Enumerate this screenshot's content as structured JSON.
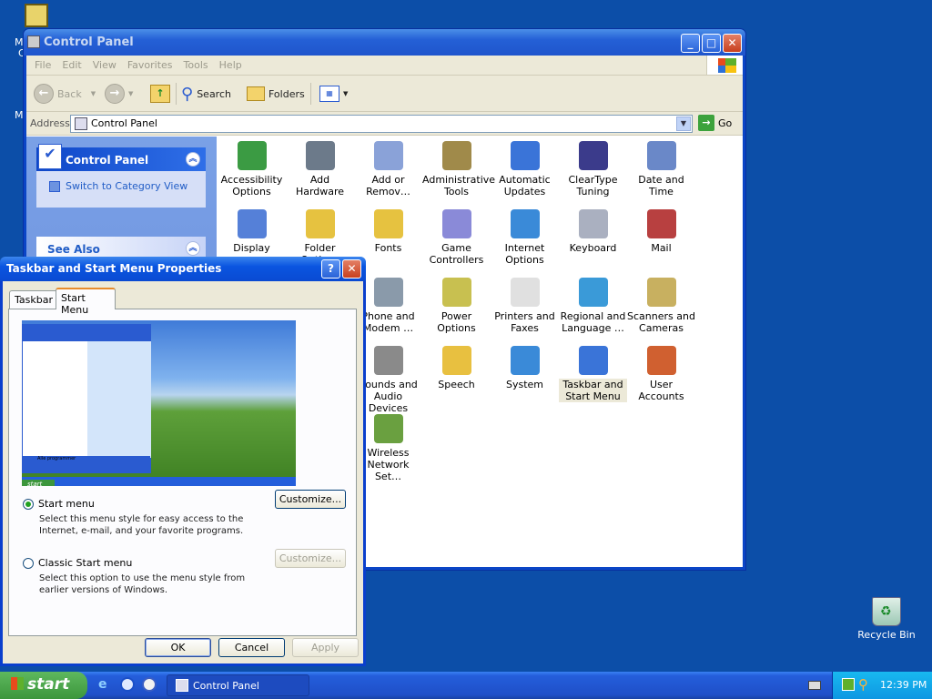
{
  "desktop": {
    "recycle_bin_label": "Recycle Bin",
    "icon_top_partial_label": "M",
    "icon_top_partial_label2": "C",
    "icon_mid_partial_label": "M"
  },
  "control_panel_window": {
    "title": "Control Panel",
    "menu": [
      "File",
      "Edit",
      "View",
      "Favorites",
      "Tools",
      "Help"
    ],
    "toolbar": {
      "back": "Back",
      "search": "Search",
      "folders": "Folders"
    },
    "address": {
      "label": "Address",
      "value": "Control Panel",
      "go": "Go"
    },
    "left_pane": {
      "control_panel_header": "Control Panel",
      "switch_view_link": "Switch to Category View",
      "see_also_header": "See Also"
    },
    "items": [
      {
        "label": "Accessibility\nOptions"
      },
      {
        "label": "Add Hardware"
      },
      {
        "label": "Add or\nRemov…"
      },
      {
        "label": "Administrative\nTools"
      },
      {
        "label": "Automatic\nUpdates"
      },
      {
        "label": "ClearType\nTuning"
      },
      {
        "label": "Date and Time"
      },
      {
        "label": "Display"
      },
      {
        "label": "Folder Options"
      },
      {
        "label": "Fonts"
      },
      {
        "label": "Game\nControllers"
      },
      {
        "label": "Internet\nOptions"
      },
      {
        "label": "Keyboard"
      },
      {
        "label": "Mail"
      },
      {
        "label": "Phone and\nModem …"
      },
      {
        "label": "Power Options"
      },
      {
        "label": "Printers and\nFaxes"
      },
      {
        "label": "Regional and\nLanguage …"
      },
      {
        "label": "Scanners and\nCameras"
      },
      {
        "label": "Sounds and\nAudio Devices"
      },
      {
        "label": "Speech"
      },
      {
        "label": "System"
      },
      {
        "label": "Taskbar and\nStart Menu"
      },
      {
        "label": "User Accounts"
      },
      {
        "label": "Wireless\nNetwork Set…"
      }
    ]
  },
  "dialog": {
    "title": "Taskbar and Start Menu Properties",
    "tabs": [
      "Taskbar",
      "Start Menu"
    ],
    "preview": {
      "start_label": "start",
      "all_programs": "Alle programmer"
    },
    "option_start_menu": {
      "label": "Start menu",
      "description": "Select this menu style for easy access to the Internet, e-mail, and your favorite programs.",
      "customize": "Customize...",
      "selected": true
    },
    "option_classic": {
      "label": "Classic Start menu",
      "description": "Select this option to use the menu style from earlier versions of Windows.",
      "customize": "Customize...",
      "selected": false
    },
    "buttons": {
      "ok": "OK",
      "cancel": "Cancel",
      "apply": "Apply"
    }
  },
  "taskbar": {
    "start": "start",
    "task_label": "Control Panel",
    "clock": "12:39 PM"
  },
  "colors": {
    "desktop": "#0c4ea8",
    "title_active": "#0a55e0",
    "title_inactive": "#2460d6",
    "taskbar": "#245edb",
    "start_green": "#3c963c",
    "tray": "#0e97e2"
  }
}
